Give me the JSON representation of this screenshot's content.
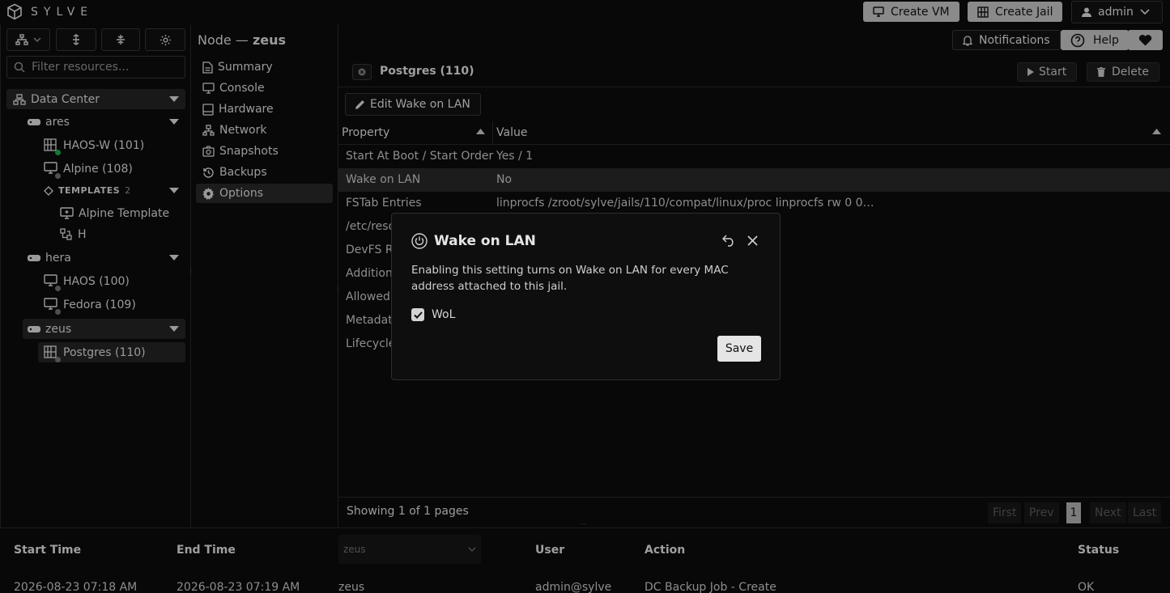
{
  "app": {
    "name": "SYLVE"
  },
  "topbar": {
    "create_vm": "Create VM",
    "create_jail": "Create Jail",
    "user": "admin"
  },
  "header": {
    "node_prefix": "Node —",
    "node_name": "zeus",
    "notifications": "Notifications",
    "help": "Help"
  },
  "sidebar": {
    "filter_placeholder": "Filter resources...",
    "tree": {
      "datacenter": "Data Center",
      "ares": "ares",
      "ares_items": [
        "HAOS-W (101)",
        "Alpine (108)"
      ],
      "templates_label": "TEMPLATES",
      "templates_count": "2",
      "templates": [
        "Alpine Template",
        "H"
      ],
      "hera": "hera",
      "hera_items": [
        "HAOS (100)",
        "Fedora (109)"
      ],
      "zeus": "zeus",
      "zeus_items": [
        "Postgres (110)"
      ]
    }
  },
  "nav": {
    "items": [
      "Summary",
      "Console",
      "Hardware",
      "Network",
      "Snapshots",
      "Backups",
      "Options"
    ]
  },
  "main": {
    "title": "Postgres (110)",
    "start": "Start",
    "delete": "Delete",
    "edit": "Edit Wake on LAN",
    "col_property": "Property",
    "col_value": "Value",
    "rows": [
      {
        "property": "Start At Boot / Start Order",
        "value": "Yes / 1"
      },
      {
        "property": "Wake on LAN",
        "value": "No"
      },
      {
        "property": "FSTab Entries",
        "value": "linprocfs /zroot/sylve/jails/110/compat/linux/proc linprocfs rw 0 0…"
      },
      {
        "property": "/etc/reso",
        "value": ""
      },
      {
        "property": "DevFS Ru",
        "value": ""
      },
      {
        "property": "Additiona",
        "value": ""
      },
      {
        "property": "Allowed",
        "value": ""
      },
      {
        "property": "Metadata",
        "value": ""
      },
      {
        "property": "Lifecycle",
        "value": ""
      }
    ],
    "pager_text": "Showing 1 of 1 pages",
    "pager": {
      "first": "First",
      "prev": "Prev",
      "page": "1",
      "next": "Next",
      "last": "Last"
    }
  },
  "tasks": {
    "headers": {
      "start": "Start Time",
      "end": "End Time",
      "node_select": "zeus",
      "user": "User",
      "action": "Action",
      "status": "Status"
    },
    "row": {
      "start": "2026-08-23 07:18 AM",
      "end": "2026-08-23 07:19 AM",
      "node": "zeus",
      "user": "admin@sylve",
      "action": "DC Backup Job - Create",
      "status": "OK"
    }
  },
  "modal": {
    "title": "Wake on LAN",
    "description": "Enabling this setting turns on Wake on LAN for every MAC address attached to this jail.",
    "checkbox_label": "WoL",
    "checked": true,
    "save": "Save"
  }
}
